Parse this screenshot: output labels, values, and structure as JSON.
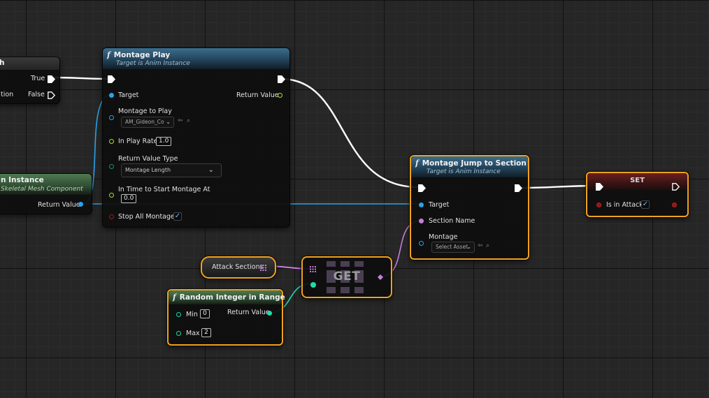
{
  "colors": {
    "exec": "#ffffff",
    "object": "#2aa3e6",
    "name": "#c77de0",
    "float": "#9ee32b",
    "int": "#1fdbab",
    "bool": "#a01a1a",
    "selection": "#f0a11c",
    "gridMajor": "#111111",
    "gridMinor": "#2c2c2c",
    "background": "#262626"
  },
  "branch_node": {
    "title_fragment": "h",
    "true_label": "True",
    "false_label": "False",
    "condition_fragment": "tion"
  },
  "anim_instance_node": {
    "title_fragment": "n Instance",
    "subtitle_fragment": "Skeletal Mesh Component",
    "return_label": "Return Value"
  },
  "montage_play": {
    "title": "Montage Play",
    "subtitle": "Target is Anim Instance",
    "target_label": "Target",
    "return_label": "Return Value",
    "montage_label": "Montage to Play",
    "montage_value": "AM_Gideon_Co",
    "play_rate_label": "In Play Rate",
    "play_rate_value": "1.0",
    "return_type_label": "Return Value Type",
    "return_type_value": "Montage Length",
    "start_time_label": "In Time to Start Montage At",
    "start_time_value": "0.0",
    "stop_all_label": "Stop All Montages",
    "stop_all_checked": true,
    "check_glyph": "✓"
  },
  "jump_to_section": {
    "title": "Montage Jump to Section",
    "subtitle": "Target is Anim Instance",
    "target_label": "Target",
    "section_label": "Section Name",
    "montage_label": "Montage",
    "montage_value": "Select Asset"
  },
  "set_node": {
    "title": "SET",
    "var_label": "Is in Attack",
    "checked": true,
    "check_glyph": "✓"
  },
  "attack_sections_node": {
    "label": "Attack Sections"
  },
  "get_node": {
    "label": "GET"
  },
  "random_int_node": {
    "title": "Random Integer in Range",
    "min_label": "Min",
    "min_value": "0",
    "max_label": "Max",
    "max_value": "2",
    "return_label": "Return Value"
  },
  "icons": {
    "function": "function-f-icon",
    "dropdown": "chevron-down-icon",
    "browse": "browse-asset-icon",
    "search": "search-icon",
    "array": "array-grid-icon"
  },
  "glyphs": {
    "function": "f",
    "chevron": "⌄",
    "browse": "⇦",
    "search": "⌕"
  }
}
